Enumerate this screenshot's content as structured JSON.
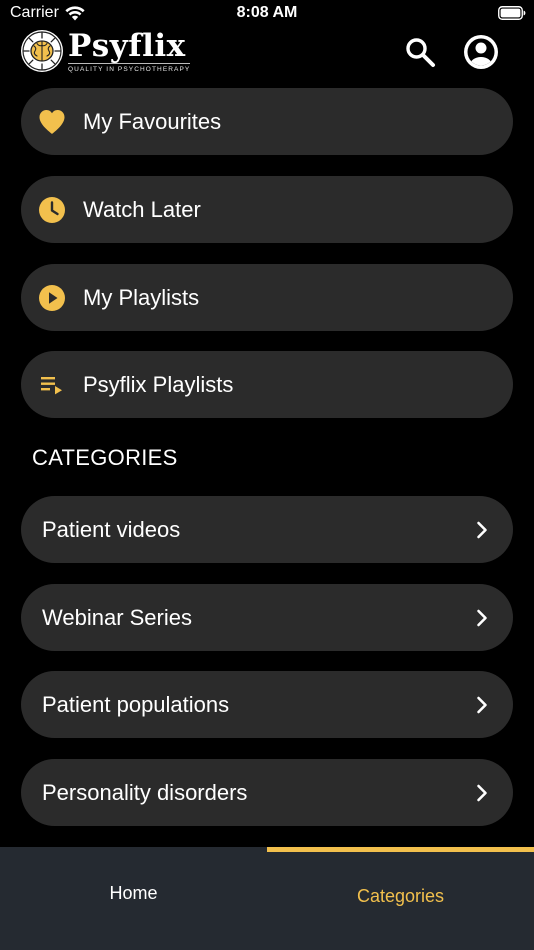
{
  "status_bar": {
    "carrier": "Carrier",
    "time": "8:08 AM"
  },
  "header": {
    "logo_name": "Psyflix",
    "logo_tagline": "QUALITY IN PSYCHOTHERAPY",
    "icons": {
      "search": "search-icon",
      "account": "account-circle-icon"
    }
  },
  "library": [
    {
      "label": "My Favourites",
      "icon": "heart-icon"
    },
    {
      "label": "Watch Later",
      "icon": "clock-icon"
    },
    {
      "label": "My Playlists",
      "icon": "play-circle-icon"
    },
    {
      "label": "Psyflix Playlists",
      "icon": "playlist-icon"
    }
  ],
  "categories": {
    "heading": "CATEGORIES",
    "items": [
      {
        "label": "Patient videos"
      },
      {
        "label": "Webinar Series"
      },
      {
        "label": "Patient populations"
      },
      {
        "label": "Personality disorders"
      }
    ]
  },
  "tab_bar": {
    "tabs": [
      {
        "label": "Home",
        "active": false
      },
      {
        "label": "Categories",
        "active": true
      }
    ]
  },
  "colors": {
    "background": "#000000",
    "pill": "#2b2b2b",
    "accent": "#f2c04d",
    "tab_bar": "#252a31",
    "text": "#ffffff"
  }
}
